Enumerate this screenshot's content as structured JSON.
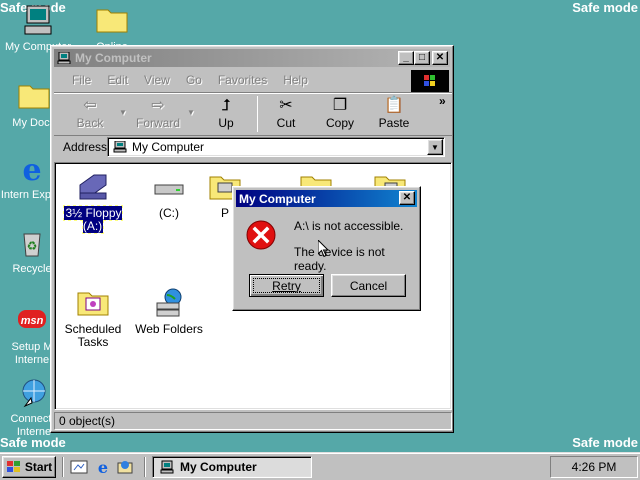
{
  "desktop": {
    "safe_mode_label": "Safe mode",
    "icons": [
      {
        "label": "My Computer"
      },
      {
        "label": "My Docu"
      },
      {
        "label": "Intern Explor"
      },
      {
        "label": "Recycle"
      },
      {
        "label": "Setup M Interne"
      },
      {
        "label": "Connect t Interne"
      },
      {
        "label": "Online"
      }
    ]
  },
  "window": {
    "title": "My Computer",
    "controls": {
      "minimize": "_",
      "maximize": "□",
      "close": "✕"
    },
    "menu": [
      {
        "label": "File"
      },
      {
        "label": "Edit"
      },
      {
        "label": "View"
      },
      {
        "label": "Go"
      },
      {
        "label": "Favorites"
      },
      {
        "label": "Help"
      }
    ],
    "toolbar": {
      "back": "Back",
      "forward": "Forward",
      "up": "Up",
      "cut": "Cut",
      "copy": "Copy",
      "paste": "Paste",
      "more": "»"
    },
    "address": {
      "label": "Address",
      "value": "My Computer"
    },
    "items": [
      {
        "label": "3½ Floppy (A:)",
        "icon": "floppy-drive-icon"
      },
      {
        "label": "(C:)",
        "icon": "hard-drive-icon"
      },
      {
        "label": "P",
        "icon": "printers-folder-icon"
      },
      {
        "label": "Scheduled Tasks",
        "icon": "scheduled-tasks-icon"
      },
      {
        "label": "Web Folders",
        "icon": "web-folders-icon"
      }
    ],
    "status": "0 object(s)"
  },
  "dialog": {
    "title": "My Computer",
    "message_line1": "A:\\ is not accessible.",
    "message_line2": "The device is not ready.",
    "retry": "Retry",
    "cancel": "Cancel",
    "close": "✕"
  },
  "taskbar": {
    "start": "Start",
    "task": "My Computer",
    "clock": "4:26 PM"
  },
  "colors": {
    "desktop": "#55a8a8",
    "titlebar_active": "#000080",
    "error_icon": "#e01010"
  }
}
